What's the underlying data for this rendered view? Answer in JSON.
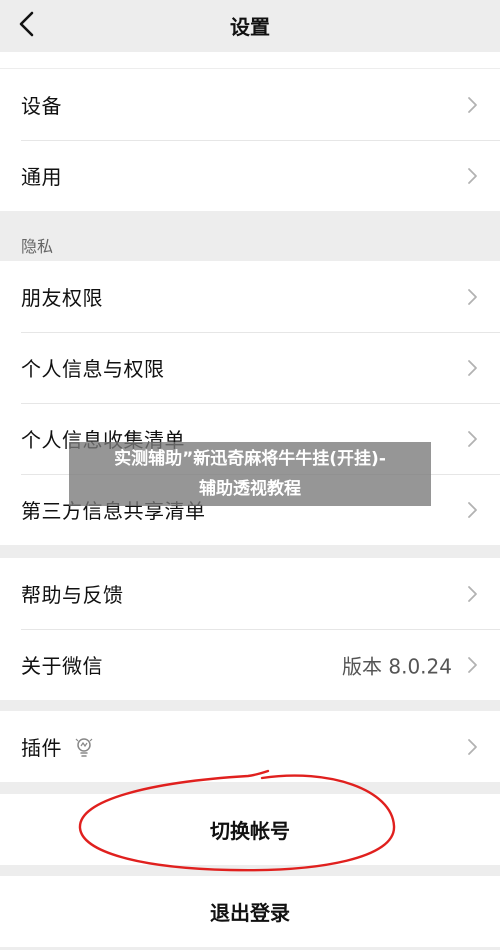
{
  "header": {
    "title": "设置",
    "back_icon": "chevron-left-icon"
  },
  "groups": {
    "general": [
      {
        "label": "设备"
      },
      {
        "label": "通用"
      }
    ],
    "privacy_title": "隐私",
    "privacy": [
      {
        "label": "朋友权限"
      },
      {
        "label": "个人信息与权限"
      },
      {
        "label": "个人信息收集清单"
      },
      {
        "label": "第三方信息共享清单"
      }
    ],
    "about": [
      {
        "label": "帮助与反馈"
      },
      {
        "label": "关于微信",
        "value": "版本 8.0.24"
      }
    ],
    "plugins": {
      "label": "插件",
      "icon": "lightbulb-icon"
    }
  },
  "actions": {
    "switch_account": "切换帐号",
    "logout": "退出登录"
  },
  "overlay": {
    "line1": "实测辅助”新迅奇麻将牛牛挂(开挂)-",
    "line2": "辅助透视教程"
  },
  "colors": {
    "background": "#ededed",
    "card": "#ffffff",
    "annotation": "#e0201e"
  }
}
